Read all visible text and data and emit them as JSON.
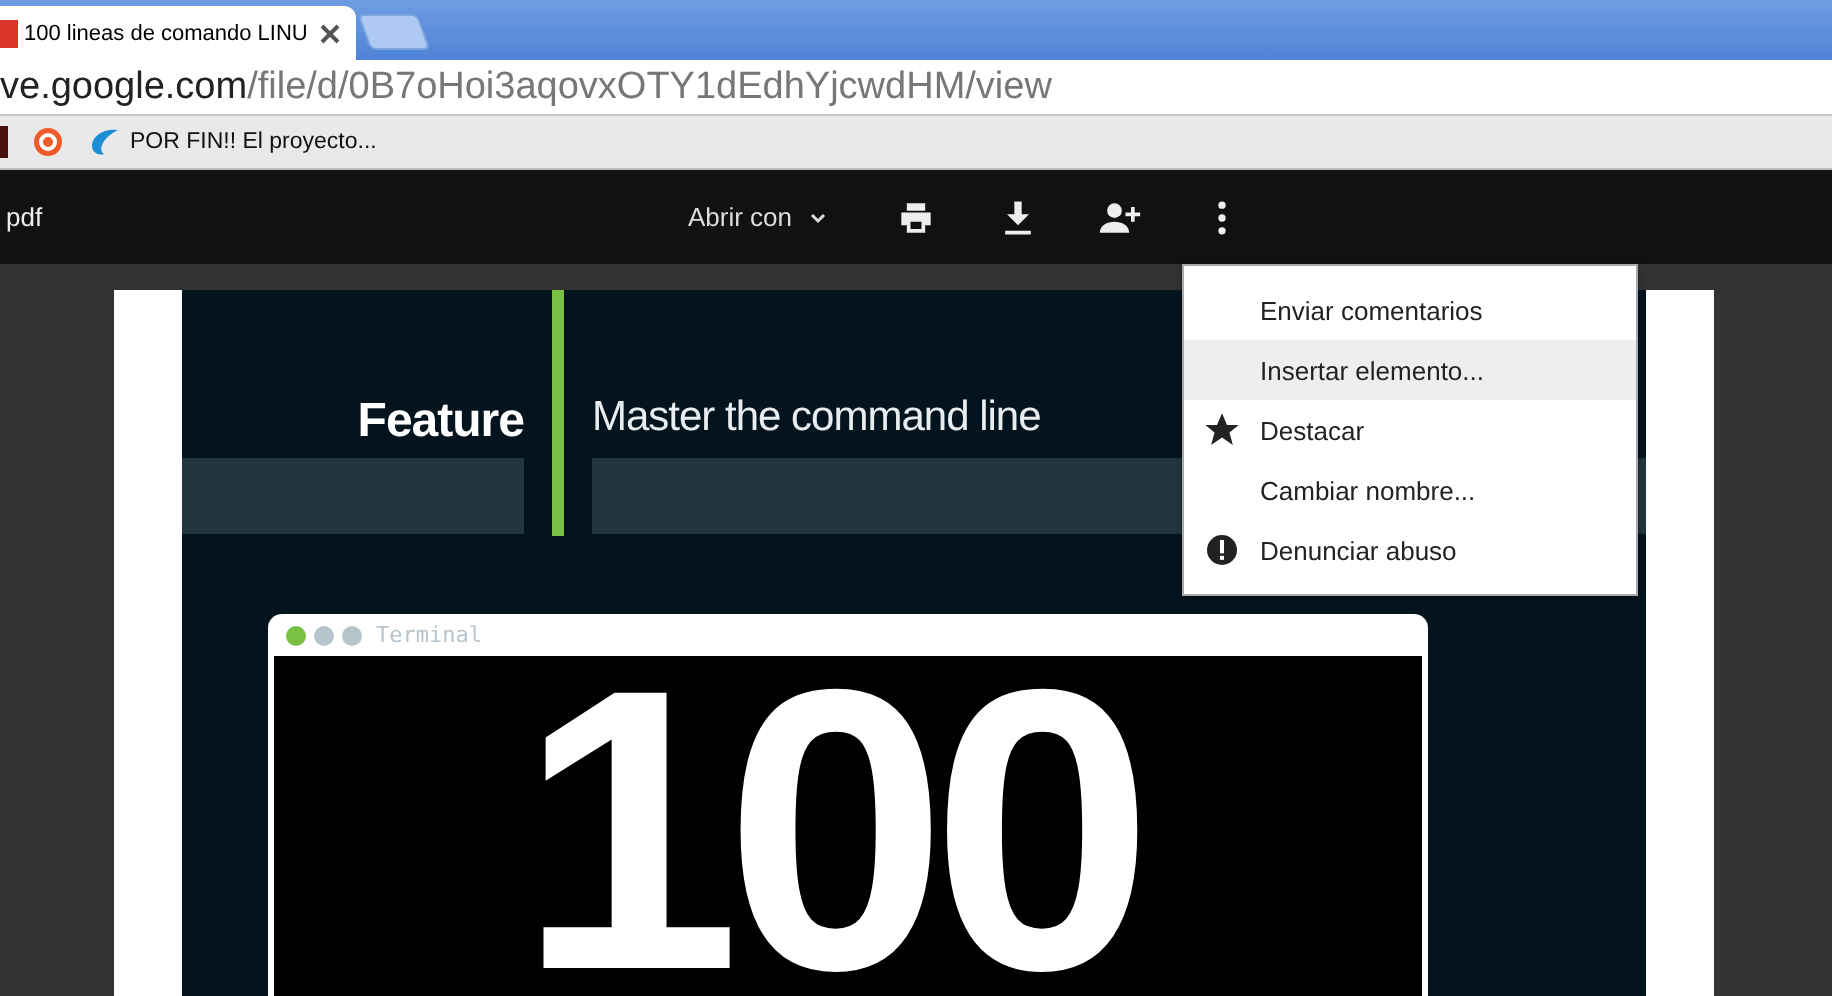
{
  "browser": {
    "tabs": [
      {
        "title": "100 lineas de comando LINU",
        "selected": true
      },
      {
        "kind": "new",
        "selected": false
      }
    ],
    "address": {
      "host": "ve.google.com",
      "path": "/file/d/0B7oHoi3aqovxOTY1dEdhYjcwdHM/view"
    },
    "bookmarks": [
      {
        "kind": "dark"
      },
      {
        "kind": "target"
      },
      {
        "kind": "wave",
        "label": "POR FIN!! El proyecto..."
      }
    ]
  },
  "viewer": {
    "file_name": "pdf",
    "open_with": "Abrir con",
    "menu": [
      {
        "label": "Enviar comentarios",
        "kind": "plain",
        "highlighted": false
      },
      {
        "label": "Insertar elemento...",
        "kind": "plain",
        "highlighted": true
      },
      {
        "label": "Destacar",
        "kind": "star",
        "highlighted": false
      },
      {
        "label": "Cambiar nombre...",
        "kind": "plain",
        "highlighted": false
      },
      {
        "label": "Denunciar abuso",
        "kind": "alert",
        "highlighted": false
      }
    ]
  },
  "document": {
    "section": "Feature",
    "headline": "Master the command line",
    "terminal_title": "Terminal",
    "big_number": "100"
  }
}
